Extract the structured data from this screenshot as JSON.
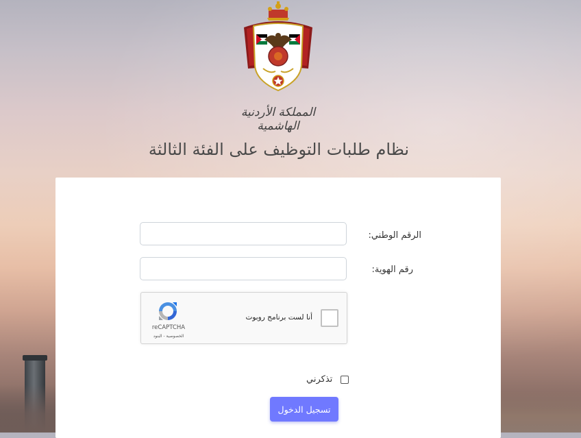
{
  "header": {
    "emblem_name": "jordan-coat-of-arms",
    "kingdom_name": "المملكة الأردنية الهاشمية",
    "title": "نظام طلبات التوظيف على الفئة الثالثة"
  },
  "form": {
    "national_id_label": "الرقم الوطني:",
    "national_id_value": "",
    "id_number_label": "رقم الهوية:",
    "id_number_value": "",
    "recaptcha": {
      "label": "أنا لست برنامج روبوت",
      "brand": "reCAPTCHA",
      "links": "الخصوصية - البنود"
    },
    "remember_label": "تذكرني",
    "submit_label": "تسجيل الدخول"
  },
  "colors": {
    "button": "#7079ff",
    "card": "#ffffff"
  }
}
